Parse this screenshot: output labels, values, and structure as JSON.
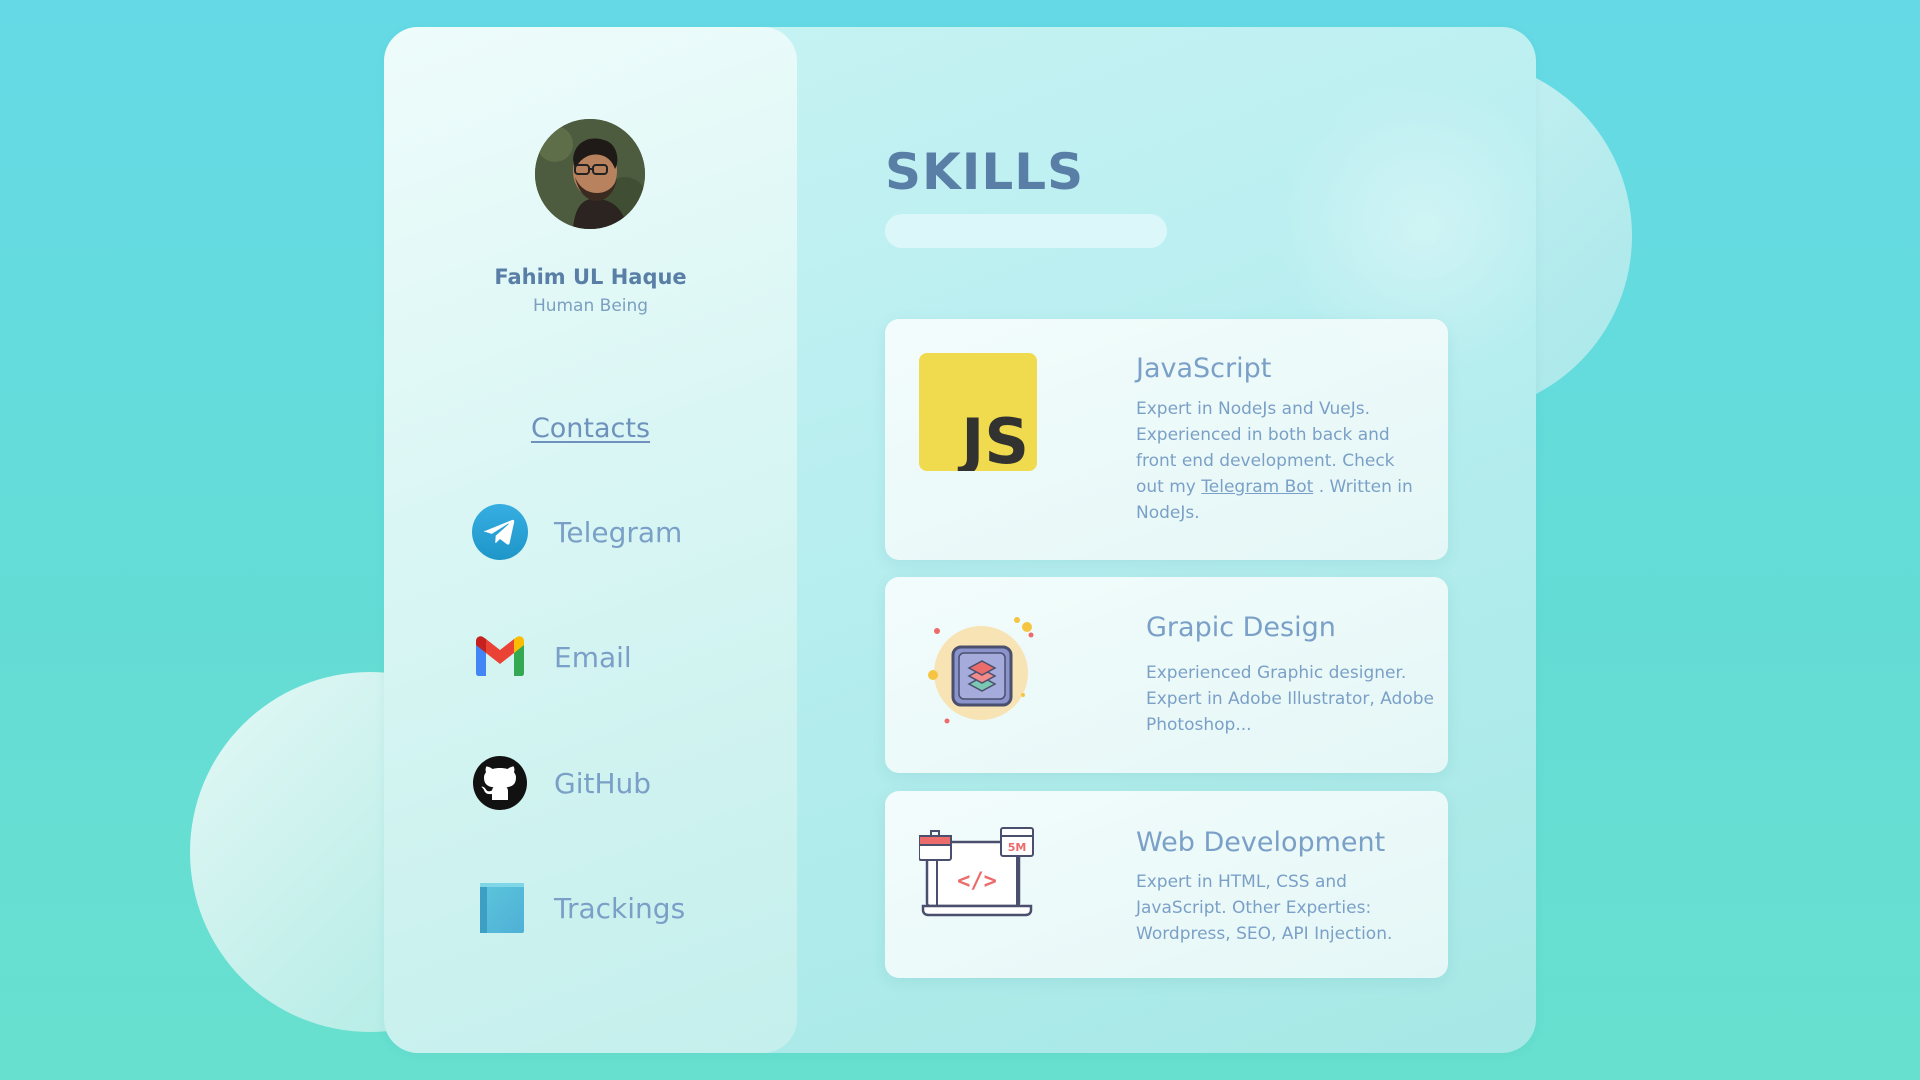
{
  "profile": {
    "name": "Fahim UL Haque",
    "role": "Human Being"
  },
  "contacts": {
    "heading": "Contacts",
    "items": [
      {
        "label": "Telegram",
        "icon": "telegram-icon"
      },
      {
        "label": "Email",
        "icon": "gmail-icon"
      },
      {
        "label": "GitHub",
        "icon": "github-icon"
      },
      {
        "label": "Trackings",
        "icon": "book-icon"
      }
    ]
  },
  "skills": {
    "title": "SKILLS",
    "cards": [
      {
        "title": "JavaScript",
        "icon": "javascript-logo-icon",
        "desc_before": "Expert in NodeJs and VueJs. Experienced in both back and front end development. Check out my ",
        "link": "Telegram Bot",
        "desc_after": " . Written in NodeJs."
      },
      {
        "title": "Grapic Design",
        "icon": "graphic-design-layers-icon",
        "desc": "Experienced Graphic designer. Expert in Adobe Illustrator, Adobe Photoshop..."
      },
      {
        "title": "Web Development",
        "icon": "web-development-laptop-icon",
        "desc": "Expert in HTML, CSS and JavaScript. Other Experties: Wordpress, SEO, API Injection."
      }
    ]
  },
  "colors": {
    "background": "#65dae6",
    "text_primary": "#5a7fa6",
    "text_secondary": "#7ba0c7",
    "js_yellow": "#f0db4f",
    "telegram_blue": "#2ca5e0"
  }
}
